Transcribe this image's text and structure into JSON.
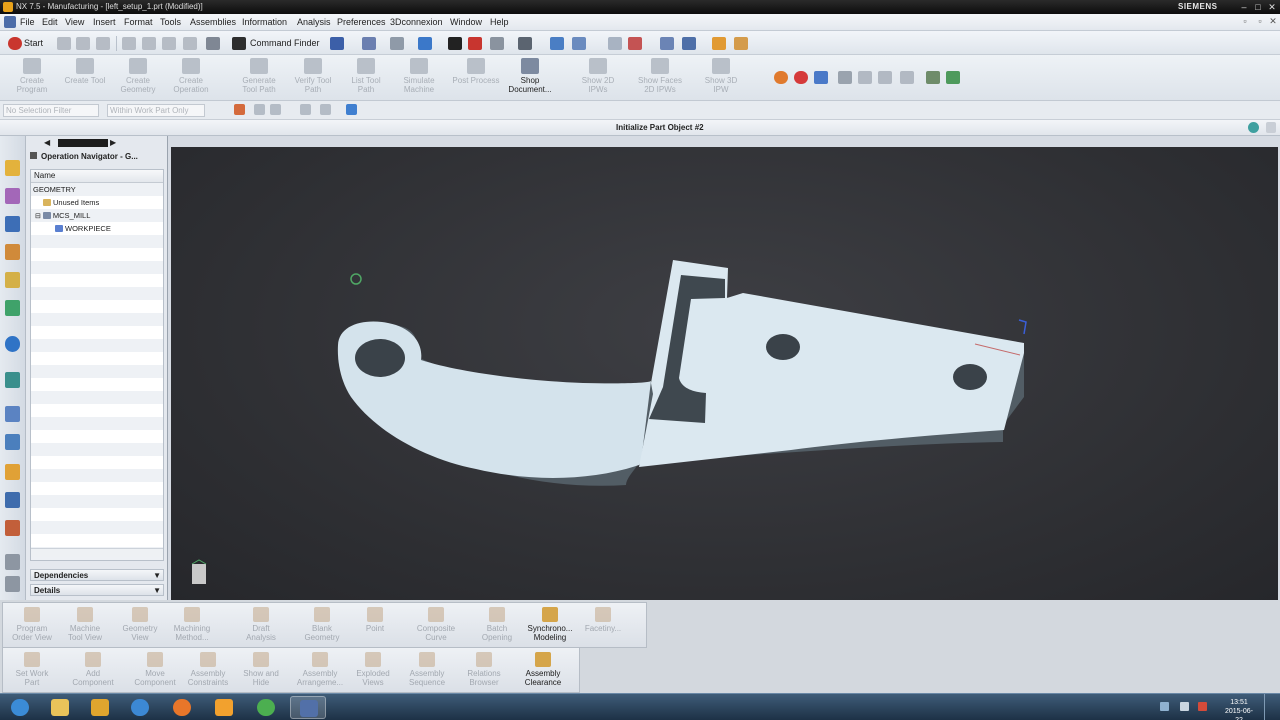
{
  "window": {
    "title": "NX 7.5 - Manufacturing - [left_setup_1.prt (Modified)]",
    "brand": "SIEMENS",
    "controls": [
      "–",
      "□",
      "✕"
    ]
  },
  "menu": {
    "items": [
      "File",
      "Edit",
      "View",
      "Insert",
      "Format",
      "Tools",
      "Assemblies",
      "Information",
      "Analysis",
      "Preferences",
      "3Dconnexion",
      "Window",
      "Help"
    ]
  },
  "toolbar": {
    "start_label": "Start",
    "command_finder_label": "Command Finder"
  },
  "ribbon_top": [
    {
      "label": "Create\nProgram",
      "state": "disabled"
    },
    {
      "label": "Create Tool",
      "state": "disabled"
    },
    {
      "label": "Create\nGeometry",
      "state": "disabled"
    },
    {
      "label": "Create\nOperation",
      "state": "disabled"
    },
    {
      "label": "Generate\nTool Path",
      "state": "disabled"
    },
    {
      "label": "Verify Tool\nPath",
      "state": "disabled"
    },
    {
      "label": "List Tool\nPath",
      "state": "disabled"
    },
    {
      "label": "Simulate\nMachine",
      "state": "disabled"
    },
    {
      "label": "Post Process",
      "state": "disabled"
    },
    {
      "label": "Shop\nDocument...",
      "state": "active"
    },
    {
      "label": "Show 2D\nIPWs",
      "state": "disabled"
    },
    {
      "label": "Show Faces\n2D IPWs",
      "state": "disabled"
    },
    {
      "label": "Show 3D\nIPW",
      "state": "disabled"
    }
  ],
  "selection_bar": {
    "filter_value": "No Selection Filter",
    "scope_value": "Within Work Part Only"
  },
  "cue_line": "Initialize Part Object #2",
  "navigator": {
    "title": "Operation Navigator - G...",
    "column": "Name",
    "tree": [
      {
        "label": "GEOMETRY",
        "level": 0,
        "icon_color": ""
      },
      {
        "label": "Unused Items",
        "level": 1,
        "icon_color": "#d9b45c"
      },
      {
        "label": "MCS_MILL",
        "level": 1,
        "icon_color": "#7a8aa6"
      },
      {
        "label": "WORKPIECE",
        "level": 2,
        "icon_color": "#5a7fd0"
      }
    ],
    "panels": [
      "Dependencies",
      "Details"
    ]
  },
  "graphics": {
    "background": "#2d2e32",
    "part_color": "#d6e6ef",
    "part_side_color": "#56626a"
  },
  "ribbon_bottom_row1": [
    {
      "label": "Program\nOrder View",
      "state": "disabled"
    },
    {
      "label": "Machine\nTool View",
      "state": "disabled"
    },
    {
      "label": "Geometry\nView",
      "state": "disabled"
    },
    {
      "label": "Machining\nMethod...",
      "state": "disabled"
    },
    {
      "label": "Draft\nAnalysis",
      "state": "disabled"
    },
    {
      "label": "Blank\nGeometry",
      "state": "disabled"
    },
    {
      "label": "Point",
      "state": "disabled"
    },
    {
      "label": "Composite\nCurve",
      "state": "disabled"
    },
    {
      "label": "Batch\nOpening",
      "state": "disabled"
    },
    {
      "label": "Synchrono...\nModeling",
      "state": "active"
    },
    {
      "label": "Facetiny...",
      "state": "disabled"
    }
  ],
  "ribbon_bottom_row2": [
    {
      "label": "Set Work\nPart",
      "state": "disabled"
    },
    {
      "label": "Add\nComponent",
      "state": "disabled"
    },
    {
      "label": "Move\nComponent",
      "state": "disabled"
    },
    {
      "label": "Assembly\nConstraints",
      "state": "disabled"
    },
    {
      "label": "Show and\nHide",
      "state": "disabled"
    },
    {
      "label": "Assembly\nArrangeme...",
      "state": "disabled"
    },
    {
      "label": "Exploded\nViews",
      "state": "disabled"
    },
    {
      "label": "Assembly\nSequence",
      "state": "disabled"
    },
    {
      "label": "Relations\nBrowser",
      "state": "disabled"
    },
    {
      "label": "Assembly\nClearance",
      "state": "active"
    }
  ],
  "taskbar": {
    "apps": [
      {
        "name": "start-orb",
        "color": "#3b8bd6"
      },
      {
        "name": "explorer-icon",
        "color": "#e9c35a"
      },
      {
        "name": "media-player-icon",
        "color": "#e0a52e"
      },
      {
        "name": "internet-explorer-icon",
        "color": "#3c88d4"
      },
      {
        "name": "firefox-icon",
        "color": "#e8762a"
      },
      {
        "name": "outlook-icon",
        "color": "#f2a12e"
      },
      {
        "name": "chrome-icon",
        "color": "#4caf50"
      },
      {
        "name": "nx-icon",
        "color": "#5270a8"
      }
    ],
    "time": "13:51",
    "date": "2015-06-22"
  }
}
